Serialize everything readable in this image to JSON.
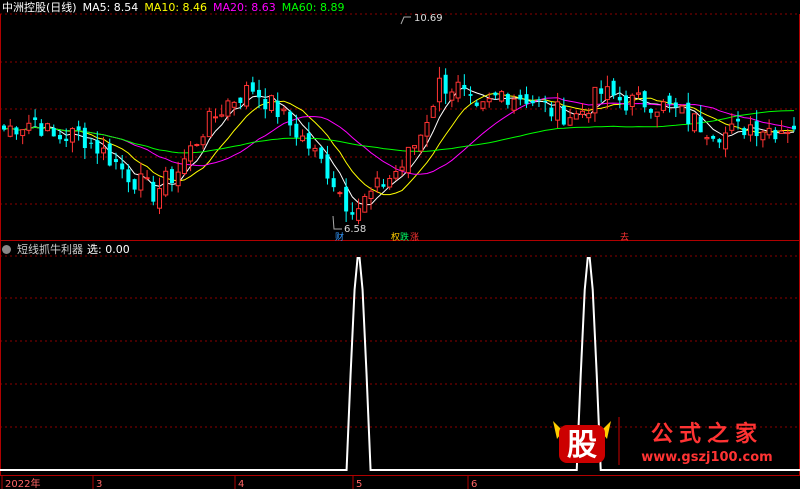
{
  "top_panel": {
    "title": "中洲控股(日线)",
    "ma_labels": [
      {
        "text": "MA5: 8.54",
        "color": "#ffffff"
      },
      {
        "text": "MA10: 8.46",
        "color": "#ffff00"
      },
      {
        "text": "MA20: 8.63",
        "color": "#ff00ff"
      },
      {
        "text": "MA60: 8.89",
        "color": "#00ff00"
      }
    ],
    "max_label": "10.69",
    "min_label": "6.58",
    "markers": [
      {
        "text": "财",
        "color": "#3399ff"
      },
      {
        "text": "权",
        "color": "#ffcc00"
      },
      {
        "text": "跌",
        "color": "#00ff66"
      },
      {
        "text": "涨",
        "color": "#ff3333"
      },
      {
        "text": "去",
        "color": "#ff3333"
      }
    ]
  },
  "bottom_panel": {
    "title": "短线抓牛利器",
    "indicator": "选: 0.00"
  },
  "x_axis": {
    "labels": [
      "2022年",
      "3",
      "4",
      "5",
      "6"
    ]
  },
  "watermark": {
    "glyph": "股",
    "text": "公式之家",
    "url": "www.gszj100.com"
  },
  "chart_data": {
    "type": "candlestick",
    "ylim": [
      6.3,
      11.0
    ],
    "indicator_ylim": [
      0,
      1
    ],
    "colors": {
      "up": "#ff3333",
      "down": "#00ffff",
      "ma5": "#ffffff",
      "ma10": "#ffff00",
      "ma20": "#ff00ff",
      "ma60": "#00ff00",
      "grid": "#8b0000"
    },
    "signal_peaks": [
      57,
      94
    ],
    "signal_peak_value": 1
  }
}
